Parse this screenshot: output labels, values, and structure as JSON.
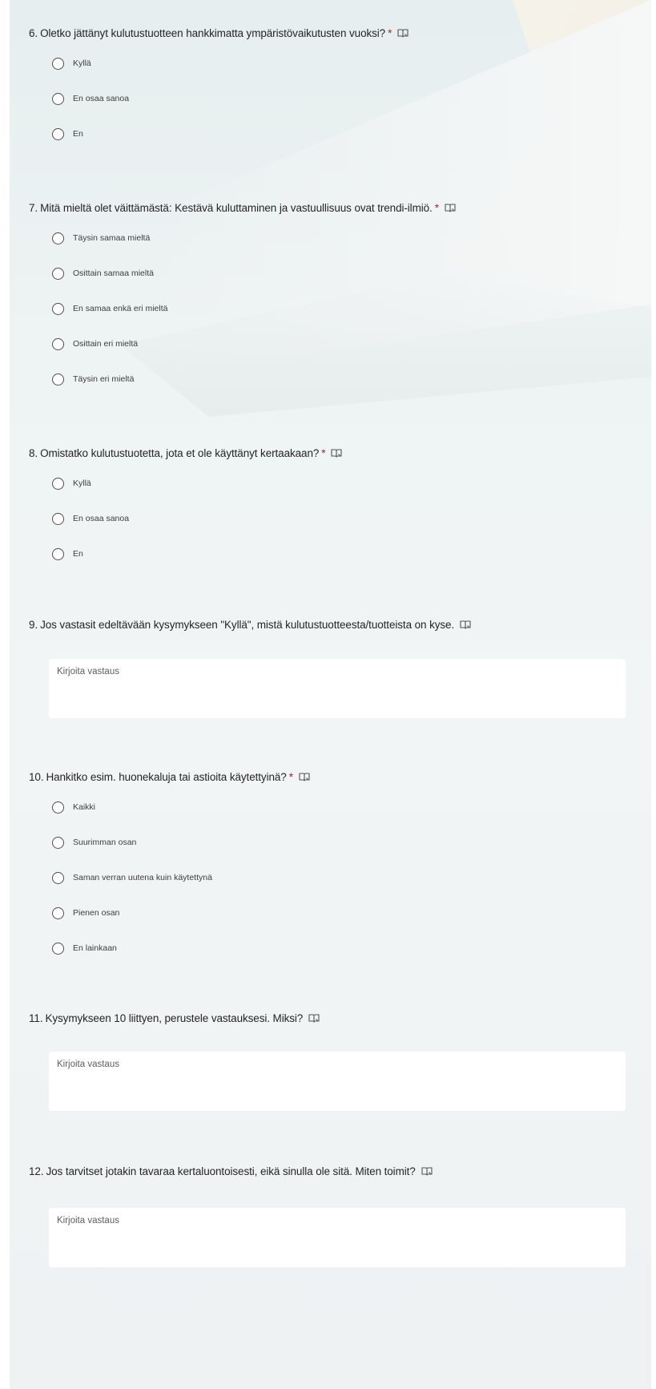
{
  "questions": [
    {
      "number": "6.",
      "text": "Oletko jättänyt kulutustuotteen hankkimatta ympäristövaikutusten vuoksi?",
      "required": "*",
      "options": [
        "Kyllä",
        "En osaa sanoa",
        "En"
      ]
    },
    {
      "number": "7.",
      "text": "Mitä mieltä olet väittämästä: Kestävä kuluttaminen ja vastuullisuus ovat trendi-ilmiö.",
      "required": "*",
      "options": [
        "Täysin samaa mieltä",
        "Osittain samaa mieltä",
        "En samaa enkä eri mieltä",
        "Osittain eri mieltä",
        "Täysin eri mieltä"
      ]
    },
    {
      "number": "8.",
      "text": "Omistatko kulutustuotetta, jota et ole käyttänyt kertaakaan?",
      "required": "*",
      "options": [
        "Kyllä",
        "En osaa sanoa",
        "En"
      ]
    },
    {
      "number": "9.",
      "text": "Jos vastasit edeltävään kysymykseen \"Kyllä\", mistä kulutustuotteesta/tuotteista on kyse.",
      "placeholder": "Kirjoita vastaus"
    },
    {
      "number": "10.",
      "text": "Hankitko esim. huonekaluja tai astioita käytettyinä?",
      "required": "*",
      "options": [
        "Kaikki",
        "Suurimman osan",
        "Saman verran uutena kuin käytettynä",
        "Pienen osan",
        "En lainkaan"
      ]
    },
    {
      "number": "11.",
      "text": "Kysymykseen 10 liittyen, perustele vastauksesi. Miksi?",
      "placeholder": "Kirjoita vastaus"
    },
    {
      "number": "12.",
      "text": "Jos tarvitset jotakin tavaraa kertaluontoisesti, eikä sinulla ole sitä. Miten toimit?",
      "placeholder": "Kirjoita vastaus"
    }
  ],
  "icons": {
    "immersive_reader": "immersive-reader-icon",
    "radio": "radio-button-icon"
  },
  "colors": {
    "required": "#a4262c",
    "text": "#252525",
    "background": "#eef3f3",
    "input": "#ffffff"
  }
}
